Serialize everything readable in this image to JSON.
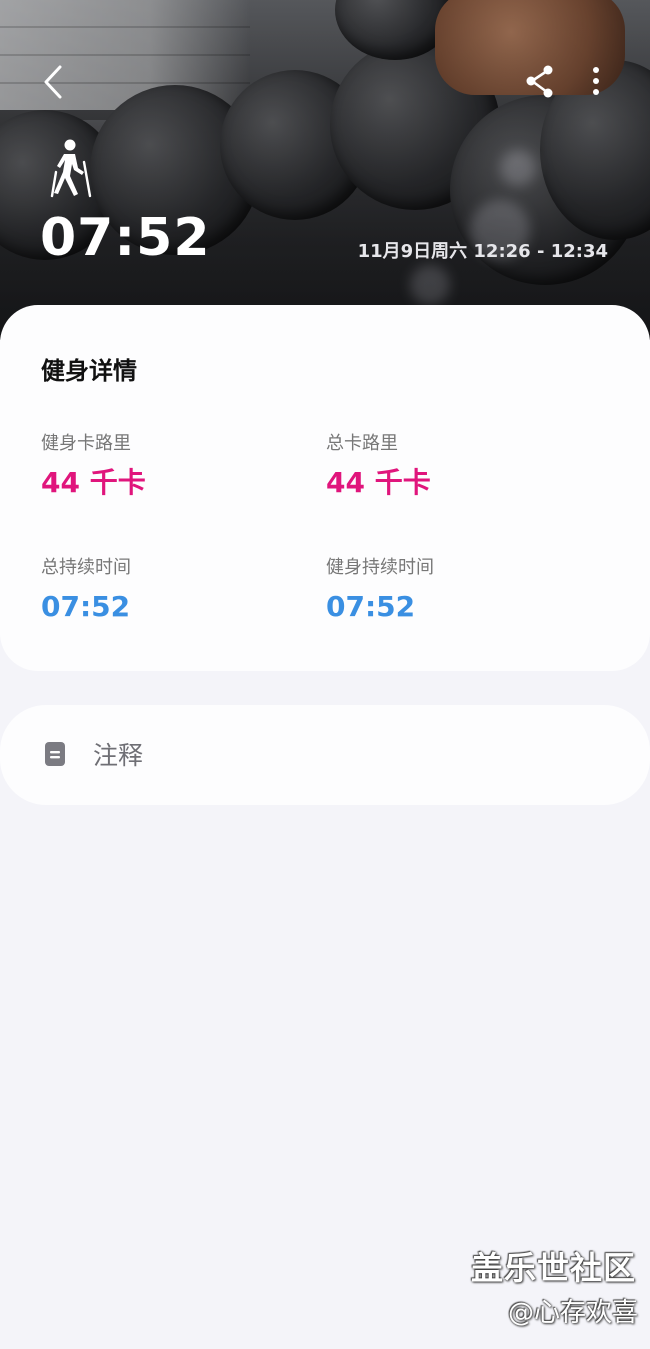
{
  "header": {
    "duration": "07:52",
    "datetime": "11月9日周六 12:26 - 12:34",
    "icons": {
      "back": "chevron-left-icon",
      "share": "share-icon",
      "more": "more-vertical-icon",
      "activity": "hiking-icon"
    }
  },
  "details": {
    "title": "健身详情",
    "metrics": [
      {
        "label": "健身卡路里",
        "value": "44 千卡"
      },
      {
        "label": "总卡路里",
        "value": "44 千卡"
      },
      {
        "label": "总持续时间",
        "value": "07:52"
      },
      {
        "label": "健身持续时间",
        "value": "07:52"
      }
    ]
  },
  "notes": {
    "label": "注释",
    "icon": "note-icon"
  },
  "watermark": {
    "line1": "盖乐世社区",
    "line2": "@心存欢喜"
  },
  "colors": {
    "calorie": "#e0157c",
    "time": "#3a8fe2",
    "background": "#f4f4f9",
    "card": "#fdfdfe"
  }
}
